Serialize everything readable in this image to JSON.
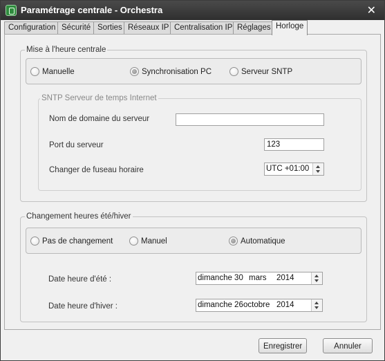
{
  "window": {
    "title": "Paramétrage centrale - Orchestra",
    "close": "✕"
  },
  "tabs": [
    "Configuration",
    "Sécurité",
    "Sorties",
    "Réseaux IP",
    "Centralisation IP",
    "Réglages",
    "Horloge"
  ],
  "active_tab": "Horloge",
  "time_setting": {
    "legend": "Mise à l'heure centrale",
    "options": [
      {
        "label": "Manuelle",
        "selected": false
      },
      {
        "label": "Synchronisation PC",
        "selected": true
      },
      {
        "label": "Serveur SNTP",
        "selected": false
      }
    ],
    "sntp": {
      "legend": "SNTP Serveur de temps Internet",
      "domain_label": "Nom de domaine du serveur",
      "domain_value": "",
      "port_label": "Port du serveur",
      "port_value": "123",
      "timezone_label": "Changer de fuseau horaire",
      "timezone_value": "UTC +01:00"
    }
  },
  "dst": {
    "legend": "Changement heures été/hiver",
    "options": [
      {
        "label": "Pas de changement",
        "selected": false
      },
      {
        "label": "Manuel",
        "selected": false
      },
      {
        "label": "Automatique",
        "selected": true
      }
    ],
    "summer_label": "Date heure d'été :",
    "summer_value": {
      "day": "dimanche 30",
      "month": "mars",
      "year": "2014"
    },
    "winter_label": "Date heure d'hiver :",
    "winter_value": {
      "day": "dimanche 26",
      "month": "octobre",
      "year": "2014"
    }
  },
  "buttons": {
    "save": "Enregistrer",
    "cancel": "Annuler"
  },
  "icons": {
    "app": "app-icon",
    "close": "close-icon",
    "spin": "spin-arrows-icon"
  }
}
